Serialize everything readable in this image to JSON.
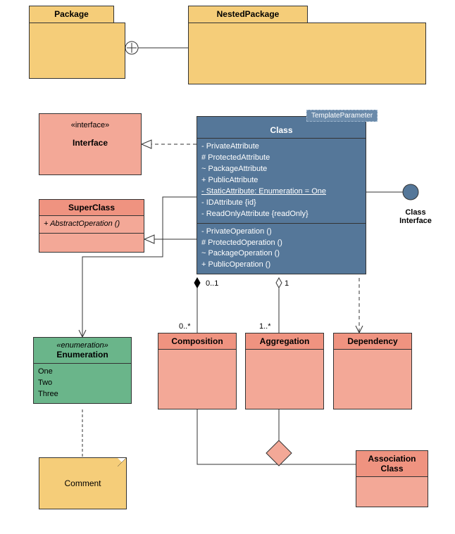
{
  "packages": {
    "package": {
      "name": "Package"
    },
    "nested": {
      "name": "NestedPackage"
    }
  },
  "interface": {
    "stereo": "«interface»",
    "name": "Interface"
  },
  "superclass": {
    "name": "SuperClass",
    "op": "+ AbstractOperation ()"
  },
  "class": {
    "name": "Class",
    "template": "TemplateParameter",
    "attrs": [
      "- PrivateAttribute",
      "# ProtectedAttribute",
      "~ PackageAttribute",
      "+ PublicAttribute",
      "- StaticAttribute: Enumeration = One",
      "- IDAttribute {id}",
      "- ReadOnlyAttribute {readOnly}"
    ],
    "ops": [
      "- PrivateOperation ()",
      "# ProtectedOperation ()",
      "~ PackageOperation ()",
      "+ PublicOperation ()"
    ]
  },
  "lollipop": {
    "line1": "Class",
    "line2": "Interface"
  },
  "enum": {
    "stereo": "«enumeration»",
    "name": "Enumeration",
    "values": [
      "One",
      "Two",
      "Three"
    ]
  },
  "composition": {
    "name": "Composition"
  },
  "aggregation": {
    "name": "Aggregation"
  },
  "dependency": {
    "name": "Dependency"
  },
  "assocclass": {
    "line1": "Association",
    "line2": "Class"
  },
  "comment": {
    "text": "Comment"
  },
  "mult": {
    "comp_near": "0..1",
    "comp_far": "0..*",
    "agg_near": "1",
    "agg_far": "1..*"
  }
}
